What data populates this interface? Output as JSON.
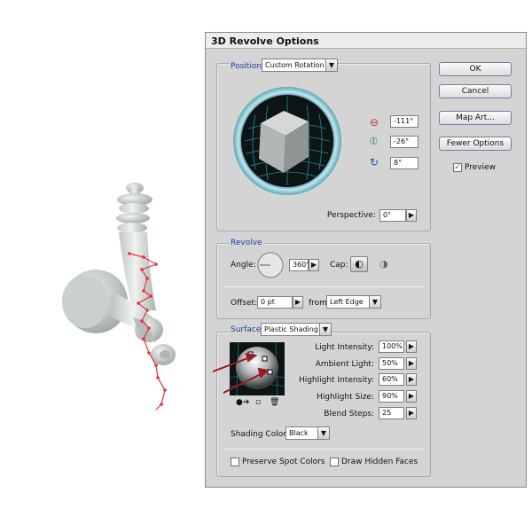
{
  "dialog": {
    "title": "3D Revolve Options",
    "buttons": {
      "ok": "OK",
      "cancel": "Cancel",
      "map_art": "Map Art...",
      "fewer_options": "Fewer Options"
    },
    "preview": {
      "label": "Preview",
      "checked": true
    }
  },
  "position": {
    "label": "Position:",
    "selected": "Custom Rotation",
    "x_rotation": "-111°",
    "y_rotation": "-26°",
    "z_rotation": "8°",
    "perspective_label": "Perspective:",
    "perspective_value": "0°"
  },
  "revolve": {
    "label": "Revolve",
    "angle_label": "Angle:",
    "angle_value": "360°",
    "cap_label": "Cap:",
    "offset_label": "Offset:",
    "offset_value": "0 pt",
    "from_label": "from",
    "from_selected": "Left Edge"
  },
  "surface": {
    "label": "Surface:",
    "selected": "Plastic Shading",
    "light_intensity_label": "Light Intensity:",
    "light_intensity_value": "100%",
    "ambient_light_label": "Ambient Light:",
    "ambient_light_value": "50%",
    "highlight_intensity_label": "Highlight Intensity:",
    "highlight_intensity_value": "60%",
    "highlight_size_label": "Highlight Size:",
    "highlight_size_value": "90%",
    "blend_steps_label": "Blend Steps:",
    "blend_steps_value": "25",
    "shading_color_label": "Shading Color:",
    "shading_color_selected": "Black",
    "preserve_spot_colors_label": "Preserve Spot Colors",
    "draw_hidden_faces_label": "Draw Hidden Faces"
  },
  "colors": {
    "group_label": "#1c3fa0",
    "path_red": "#e8303a",
    "arrow_red": "#9a1a22",
    "sphere_teal": "#1e8f8f"
  },
  "icons": [
    "x-rotation-icon",
    "y-rotation-icon",
    "z-rotation-icon",
    "cap-on-icon",
    "cap-off-icon",
    "move-light-back-icon",
    "new-light-icon",
    "delete-light-icon",
    "trackball-cube",
    "lighting-sphere"
  ]
}
